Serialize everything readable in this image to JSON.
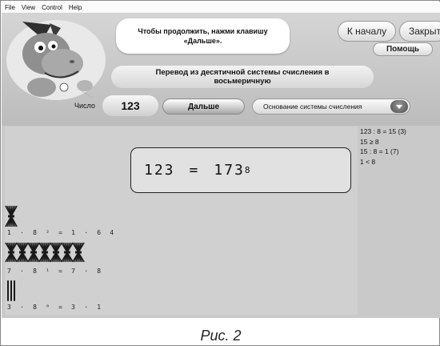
{
  "menu": [
    "File",
    "View",
    "Control",
    "Help"
  ],
  "hint": "Чтобы продолжить, нажми клавишу «Дальше».",
  "buttons": {
    "home": "К началу",
    "close": "Закрыть",
    "help": "Помощь",
    "next": "Дальше"
  },
  "title": "Перевод из десятичной системы счисления в восьмеричную",
  "number": {
    "label": "Число",
    "value": "123"
  },
  "base_dropdown": {
    "selected": "Основание системы счисления"
  },
  "result": {
    "decimal": "123",
    "equals": "=",
    "octal": "173",
    "base": "8"
  },
  "place_values": [
    {
      "count": 1,
      "formula": "1 · 8 ² = 1 · 6 4"
    },
    {
      "count": 7,
      "formula": "7 · 8 ¹ = 7 · 8"
    },
    {
      "count": 3,
      "formula": "3 · 8 ⁰ = 3 · 1"
    }
  ],
  "steps": [
    "123 : 8 = 15 (3)",
    "15 ≥ 8",
    "15 : 8 = 1 (7)",
    "1 < 8"
  ],
  "caption": "Рис. 2",
  "icons": {
    "mascot": "hippo-mascot-icon",
    "dropdown": "chevron-down-icon",
    "bundle": "stick-bundle-icon",
    "stick": "stick-icon"
  }
}
